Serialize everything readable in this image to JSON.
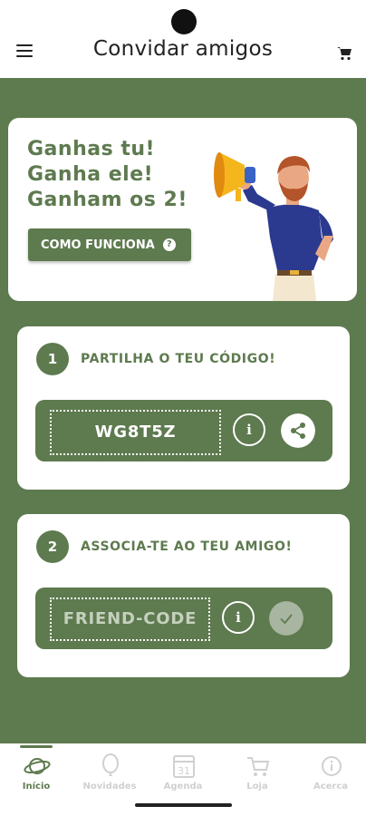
{
  "header": {
    "title": "Convidar amigos",
    "menu_icon": "hamburger-icon",
    "cart_icon": "cart-icon"
  },
  "hero": {
    "line1": "Ganhas tu!",
    "line2": "Ganha ele!",
    "line3": "Ganham os 2!",
    "button_label": "COMO FUNCIONA",
    "button_icon": "question-icon",
    "illustration": "man-with-megaphone"
  },
  "step1": {
    "number": "1",
    "title": "PARTILHA O TEU CÓDIGO!",
    "code": "WG8T5Z",
    "info_symbol": "i",
    "share_icon": "share-icon"
  },
  "step2": {
    "number": "2",
    "title": "ASSOCIA-TE AO TEU AMIGO!",
    "placeholder": "FRIEND-CODE",
    "info_symbol": "i",
    "confirm_icon": "check-icon"
  },
  "tabs": [
    {
      "label": "Início",
      "icon": "planet-icon",
      "active": true
    },
    {
      "label": "Novidades",
      "icon": "balloon-icon",
      "active": false
    },
    {
      "label": "Agenda",
      "icon": "calendar-icon",
      "active": false,
      "icon_text": "31"
    },
    {
      "label": "Loja",
      "icon": "cart-icon",
      "active": false
    },
    {
      "label": "Acerca",
      "icon": "info-icon",
      "active": false
    }
  ],
  "colors": {
    "primary": "#5e7a4f",
    "disabled": "#a8b5a0",
    "tab_inactive": "#d0d0d0"
  }
}
